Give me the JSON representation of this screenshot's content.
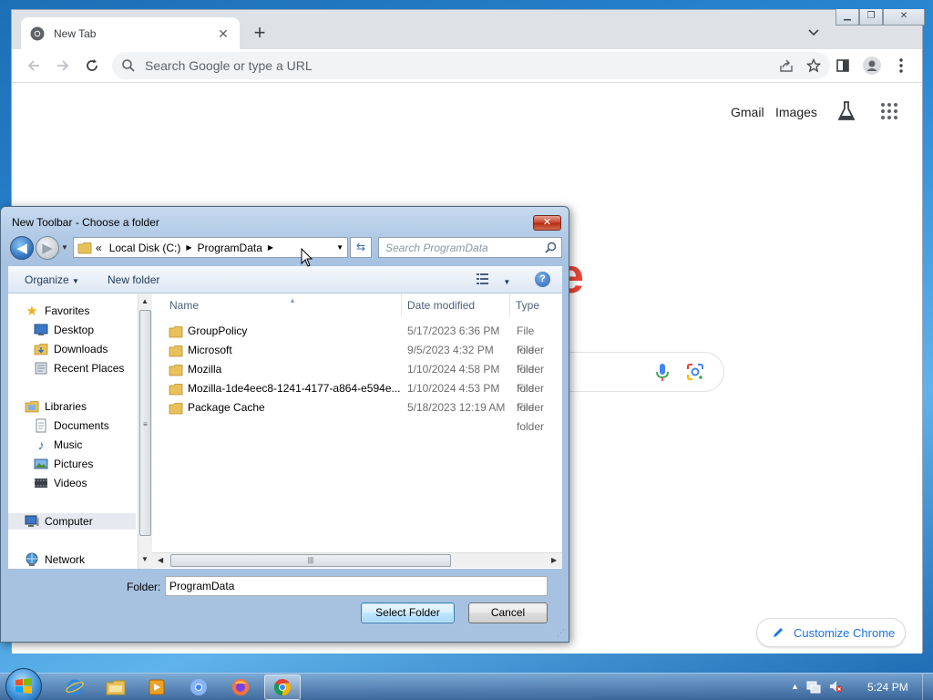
{
  "browser": {
    "tab_title": "New Tab",
    "omnibox_placeholder": "Search Google or type a URL",
    "links": {
      "gmail": "Gmail",
      "images": "Images"
    },
    "google_letter": "e",
    "customize_label": "Customize Chrome"
  },
  "dialog": {
    "title": "New Toolbar - Choose a folder",
    "close_glyph": "✕",
    "address": {
      "overflow": "«",
      "segments": [
        "Local Disk (C:)",
        "ProgramData"
      ]
    },
    "search_placeholder": "Search ProgramData",
    "commands": {
      "organize": "Organize",
      "new_folder": "New folder"
    },
    "help_glyph": "?",
    "nav": {
      "favorites": "Favorites",
      "desktop": "Desktop",
      "downloads": "Downloads",
      "recent_places": "Recent Places",
      "libraries": "Libraries",
      "documents": "Documents",
      "music": "Music",
      "pictures": "Pictures",
      "videos": "Videos",
      "computer": "Computer",
      "network": "Network"
    },
    "columns": {
      "name": "Name",
      "date_modified": "Date modified",
      "type": "Type"
    },
    "files": [
      {
        "name": "GroupPolicy",
        "date": "5/17/2023 6:36 PM",
        "type": "File folder"
      },
      {
        "name": "Microsoft",
        "date": "9/5/2023 4:32 PM",
        "type": "File folder"
      },
      {
        "name": "Mozilla",
        "date": "1/10/2024 4:58 PM",
        "type": "File folder"
      },
      {
        "name": "Mozilla-1de4eec8-1241-4177-a864-e594e...",
        "date": "1/10/2024 4:53 PM",
        "type": "File folder"
      },
      {
        "name": "Package Cache",
        "date": "5/18/2023 12:19 AM",
        "type": "File folder"
      }
    ],
    "folder_label": "Folder:",
    "folder_value": "ProgramData",
    "select_button": "Select Folder",
    "cancel_button": "Cancel"
  },
  "taskbar": {
    "clock": "5:24 PM",
    "apps": [
      "internet-explorer-icon",
      "file-explorer-icon",
      "media-player-icon",
      "chrome-alt-icon",
      "firefox-icon",
      "chrome-icon"
    ]
  },
  "colors": {
    "chrome_blue": "#1a73e8",
    "google_red": "#ea4335",
    "dialog_frame": "#a7c2e1",
    "taskbar": "#3c6496"
  }
}
